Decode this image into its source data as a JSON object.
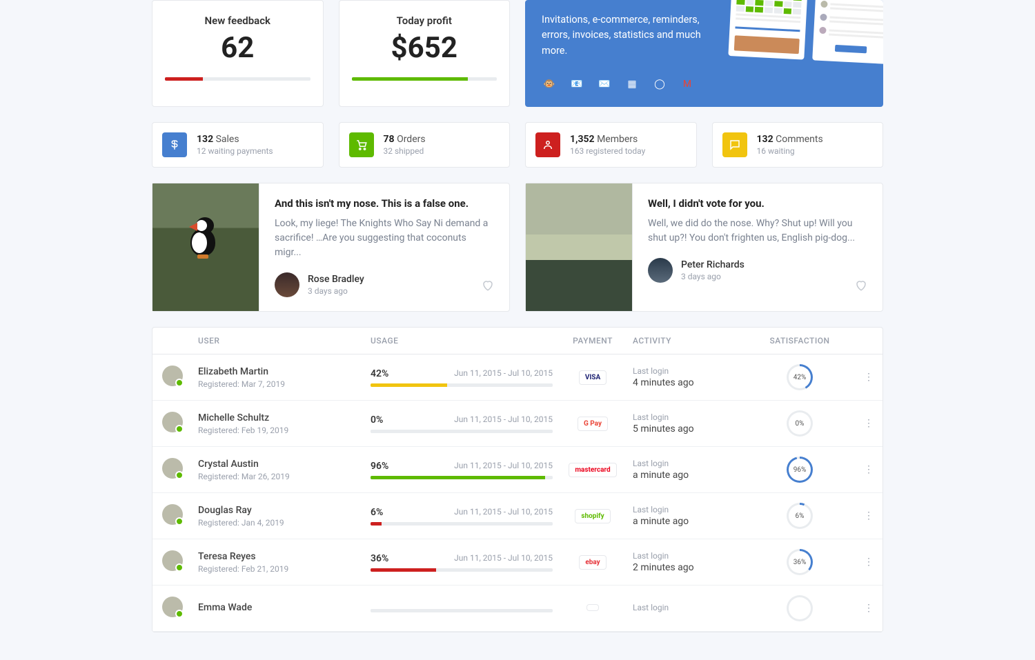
{
  "stats": {
    "feedback": {
      "label": "New feedback",
      "value": "62",
      "progress": 26,
      "color": "#cd201f"
    },
    "profit": {
      "label": "Today profit",
      "value": "$652",
      "progress": 80,
      "color": "#5eba00"
    }
  },
  "banner": {
    "text": "Invitations, e-commerce, reminders, errors, invoices, statistics and much more."
  },
  "minis": {
    "sales": {
      "num": "132",
      "label": "Sales",
      "sub": "12 waiting payments",
      "color": "#467fcf"
    },
    "orders": {
      "num": "78",
      "label": "Orders",
      "sub": "32 shipped",
      "color": "#5eba00"
    },
    "members": {
      "num": "1,352",
      "label": "Members",
      "sub": "163 registered today",
      "color": "#cd201f"
    },
    "comments": {
      "num": "132",
      "label": "Comments",
      "sub": "16 waiting",
      "color": "#f1c40f"
    }
  },
  "posts": {
    "p1": {
      "title": "And this isn't my nose. This is a false one.",
      "text": "Look, my liege! The Knights Who Say Ni demand a sacrifice! …Are you suggesting that coconuts migr...",
      "author": "Rose Bradley",
      "time": "3 days ago"
    },
    "p2": {
      "title": "Well, I didn't vote for you.",
      "text": "Well, we did do the nose. Why? Shut up! Will you shut up?! You don't frighten us, English pig-dog...",
      "author": "Peter Richards",
      "time": "3 days ago"
    }
  },
  "table": {
    "headers": {
      "user": "USER",
      "usage": "USAGE",
      "payment": "PAYMENT",
      "activity": "ACTIVITY",
      "satisfaction": "SATISFACTION"
    },
    "activity_label": "Last login",
    "rows": [
      {
        "name": "Elizabeth Martin",
        "reg": "Registered: Mar 7, 2019",
        "pct": "42%",
        "pct_n": 42,
        "bar_color": "#f1c40f",
        "range": "Jun 11, 2015 - Jul 10, 2015",
        "pay": "VISA",
        "pay_color": "#1a1f71",
        "activity": "4 minutes ago",
        "sat": "42%",
        "deg": "151deg"
      },
      {
        "name": "Michelle Schultz",
        "reg": "Registered: Feb 19, 2019",
        "pct": "0%",
        "pct_n": 0,
        "bar_color": "#cd201f",
        "range": "Jun 11, 2015 - Jul 10, 2015",
        "pay": "G Pay",
        "pay_color": "#ea4335",
        "activity": "5 minutes ago",
        "sat": "0%",
        "deg": "0deg"
      },
      {
        "name": "Crystal Austin",
        "reg": "Registered: Mar 26, 2019",
        "pct": "96%",
        "pct_n": 96,
        "bar_color": "#5eba00",
        "range": "Jun 11, 2015 - Jul 10, 2015",
        "pay": "mastercard",
        "pay_color": "#eb001b",
        "activity": "a minute ago",
        "sat": "96%",
        "deg": "346deg"
      },
      {
        "name": "Douglas Ray",
        "reg": "Registered: Jan 4, 2019",
        "pct": "6%",
        "pct_n": 6,
        "bar_color": "#cd201f",
        "range": "Jun 11, 2015 - Jul 10, 2015",
        "pay": "shopify",
        "pay_color": "#5eba00",
        "activity": "a minute ago",
        "sat": "6%",
        "deg": "22deg"
      },
      {
        "name": "Teresa Reyes",
        "reg": "Registered: Feb 21, 2019",
        "pct": "36%",
        "pct_n": 36,
        "bar_color": "#cd201f",
        "range": "Jun 11, 2015 - Jul 10, 2015",
        "pay": "ebay",
        "pay_color": "#e53238",
        "activity": "2 minutes ago",
        "sat": "36%",
        "deg": "130deg"
      },
      {
        "name": "Emma Wade",
        "reg": "",
        "pct": "",
        "pct_n": 0,
        "bar_color": "#e9ecef",
        "range": "",
        "pay": "",
        "pay_color": "#999",
        "activity": "",
        "sat": "",
        "deg": "0deg"
      }
    ]
  }
}
